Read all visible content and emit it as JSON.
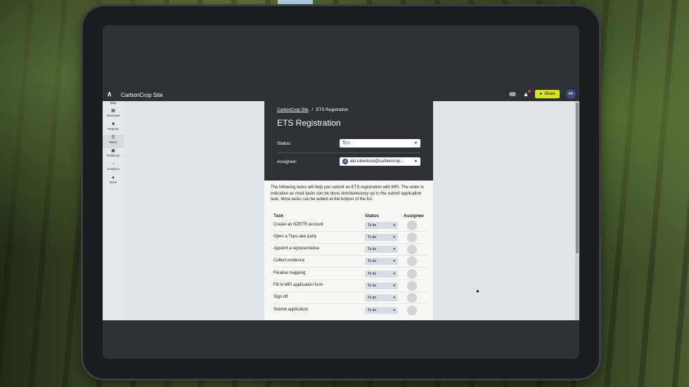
{
  "colors": {
    "accent": "#d6e61b",
    "header_bg": "#2e3038",
    "sidebar_bg": "#e5e8ee",
    "panel_light": "#f7f7f4",
    "status_pill": "#d7dde6",
    "avatar": "#3c4a7a"
  },
  "header": {
    "site_title": "CarbonCrop Site",
    "share_label": "Share",
    "avatar_initials": "AR"
  },
  "sidebar": {
    "items": [
      {
        "label": "Map",
        "icon": "map-icon"
      },
      {
        "label": "Overview",
        "icon": "grid-icon"
      },
      {
        "label": "Reports",
        "icon": "document-icon"
      },
      {
        "label": "Tasks",
        "icon": "list-icon"
      },
      {
        "label": "Fieldscan",
        "icon": "camera-icon"
      },
      {
        "label": "Analytics",
        "icon": "pie-icon"
      },
      {
        "label": "Drive",
        "icon": "drive-icon"
      }
    ]
  },
  "panel": {
    "breadcrumb_link": "CarbonCrop Site",
    "breadcrumb_sep": "/",
    "breadcrumb_current": "ETS Registration",
    "title": "ETS Registration",
    "status_label": "Status:",
    "status_value": "To c",
    "assignee_label": "Assignee:",
    "assignee_initials": "AR",
    "assignee_value": "abi.robertson@carboncrop..."
  },
  "tasks": {
    "intro": "The following tasks will help you submit an ETS registration with MPI. The order is indicative as most tasks can be done simultaneously up to the submit application task. More tasks can be added at the bottom of the list.",
    "headers": {
      "task": "Task",
      "status": "Status",
      "assignee": "Assignee"
    },
    "rows": [
      {
        "name": "Create an NZETR account",
        "status": "To do"
      },
      {
        "name": "Open a Tupu-ake party",
        "status": "To do"
      },
      {
        "name": "Appoint a representative",
        "status": "To do"
      },
      {
        "name": "Collect evidence",
        "status": "To do"
      },
      {
        "name": "Finalise mapping",
        "status": "To do"
      },
      {
        "name": "Fill in MPI application form",
        "status": "To do"
      },
      {
        "name": "Sign off",
        "status": "To do"
      },
      {
        "name": "Submit application",
        "status": "To do"
      }
    ]
  }
}
